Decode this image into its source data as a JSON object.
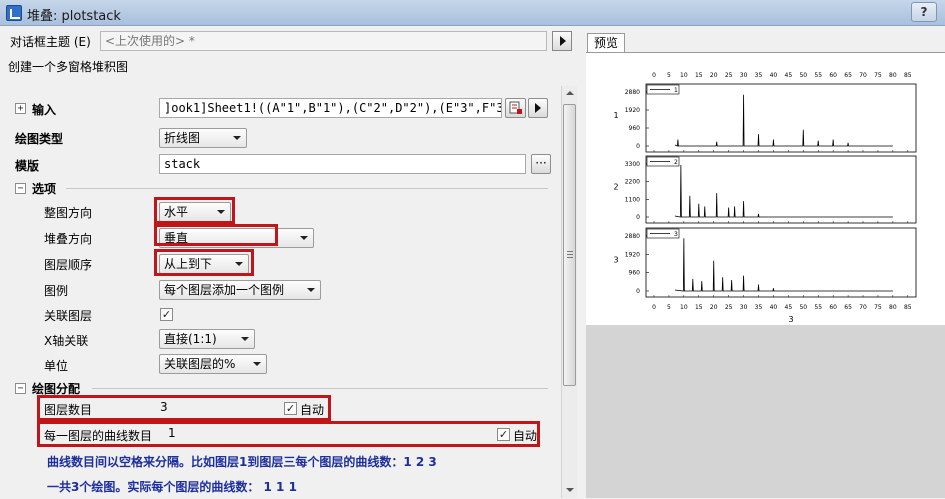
{
  "window": {
    "title": "堆叠: plotstack",
    "help": "?"
  },
  "dialog_theme": {
    "label": "对话框主题 (E)",
    "value": "<上次使用的> *"
  },
  "description": "创建一个多窗格堆积图",
  "input": {
    "label": "输入",
    "value": "]ook1]Sheet1!((A\"1\",B\"1\"),(C\"2\",D\"2\"),(E\"3\",F\"3\")"
  },
  "plot_type": {
    "label": "绘图类型",
    "value": "折线图"
  },
  "template": {
    "label": "模版",
    "value": "stack",
    "browse": "···"
  },
  "options": {
    "header": "选项",
    "overall_direction": {
      "label": "整图方向",
      "value": "水平"
    },
    "stack_direction": {
      "label": "堆叠方向",
      "value": "垂直"
    },
    "layer_order": {
      "label": "图层顺序",
      "value": "从上到下"
    },
    "legend": {
      "label": "图例",
      "value": "每个图层添加一个图例"
    },
    "link_layers": {
      "label": "关联图层",
      "checked": true,
      "mark": "✓"
    },
    "x_axis_link": {
      "label": "X轴关联",
      "value": "直接(1:1)"
    },
    "unit": {
      "label": "单位",
      "value": "关联图层的%"
    }
  },
  "plot_assignment": {
    "header": "绘图分配",
    "layer_count": {
      "label": "图层数目",
      "value": "3",
      "auto_label": "自动",
      "auto_checked": true
    },
    "curves_per_layer": {
      "label": "每一图层的曲线数目",
      "value": "1",
      "auto_label": "自动",
      "auto_checked": true
    },
    "note1": "曲线数目间以空格来分隔。比如图层1到图层三每个图层的曲线数：1 2 3",
    "note2": "一共3个绘图。实际每个图层的曲线数： 1 1 1"
  },
  "preview": {
    "tab": "预览",
    "x_ticks": [
      "0",
      "5",
      "10",
      "15",
      "20",
      "25",
      "30",
      "35",
      "40",
      "45",
      "50",
      "55",
      "60",
      "65",
      "70",
      "75",
      "80",
      "85"
    ],
    "x_label": "3",
    "panels": [
      {
        "legend": "1",
        "ylabel": "1",
        "yticks": [
          "0",
          "960",
          "1920",
          "2880"
        ]
      },
      {
        "legend": "2",
        "ylabel": "2",
        "yticks": [
          "0",
          "1100",
          "2200",
          "3300"
        ]
      },
      {
        "legend": "3",
        "ylabel": "3",
        "yticks": [
          "0",
          "960",
          "1920",
          "2880"
        ]
      }
    ]
  },
  "colors": {
    "highlight": "#c0161a",
    "note_text": "#1d2f9c"
  }
}
